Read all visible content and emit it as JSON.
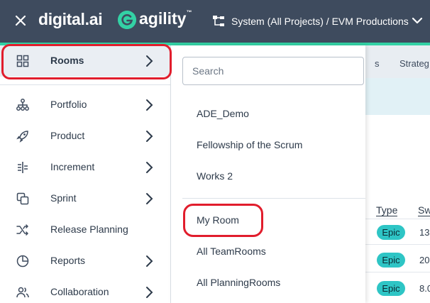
{
  "header": {
    "brand_digital": "digital.ai",
    "brand_agility": "agility",
    "trademark": "™",
    "project_breadcrumb": "System (All Projects) / EVM Productions",
    "close_icon": "close-icon",
    "colors": {
      "background": "#3e4b5e",
      "accent": "#33d1a5"
    }
  },
  "nav": {
    "items": [
      {
        "label": "Rooms",
        "icon": "grid-icon",
        "has_submenu": true,
        "active": true
      },
      {
        "label": "Portfolio",
        "icon": "hierarchy-icon",
        "has_submenu": true
      },
      {
        "label": "Product",
        "icon": "rocket-icon",
        "has_submenu": true
      },
      {
        "label": "Increment",
        "icon": "increment-icon",
        "has_submenu": true
      },
      {
        "label": "Sprint",
        "icon": "sprint-icon",
        "has_submenu": true
      },
      {
        "label": "Release Planning",
        "icon": "shuffle-icon",
        "has_submenu": false
      },
      {
        "label": "Reports",
        "icon": "pie-chart-icon",
        "has_submenu": true
      },
      {
        "label": "Collaboration",
        "icon": "people-icon",
        "has_submenu": true
      }
    ]
  },
  "rooms_menu": {
    "search_placeholder": "Search",
    "rooms": [
      "ADE_Demo",
      "Fellowship of the Scrum",
      "Works 2"
    ],
    "links": [
      "My Room",
      "All TeamRooms",
      "All PlanningRooms"
    ]
  },
  "background_page": {
    "tabs": [
      "s",
      "Strateg"
    ],
    "columns": [
      "Type",
      "Sw"
    ],
    "rows": [
      {
        "type": "Epic",
        "value": "13"
      },
      {
        "type": "Epic",
        "value": "20"
      },
      {
        "type": "Epic",
        "value": "8.0"
      }
    ]
  },
  "annotation_color": "#e11d2c"
}
